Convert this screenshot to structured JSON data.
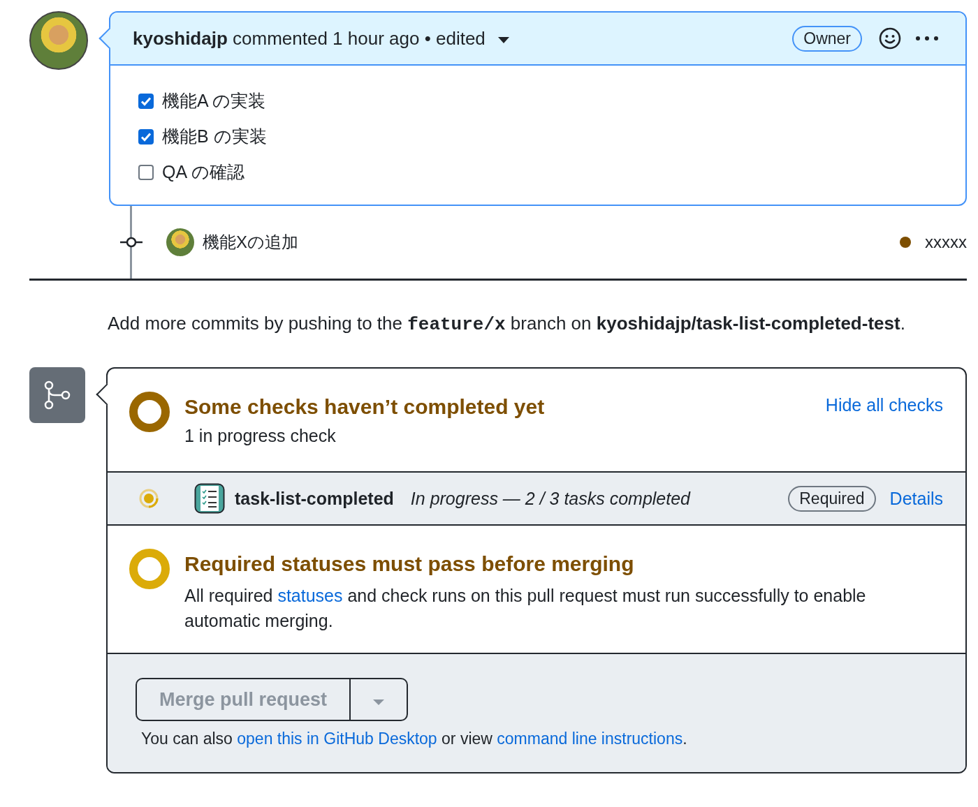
{
  "comment": {
    "author": "kyoshidajp",
    "action": "commented 1 hour ago",
    "separator": "•",
    "edited": "edited",
    "badge": "Owner",
    "tasks": [
      {
        "label": "機能A の実装",
        "checked": true
      },
      {
        "label": "機能B の実装",
        "checked": true
      },
      {
        "label": "QA の確認",
        "checked": false
      }
    ]
  },
  "commit": {
    "message": "機能Xの追加",
    "sha": "xxxxx"
  },
  "branch_note": "Add more commits by pushing to the **feature/x** branch on **kyoshidajp/task-list-completed-test**.",
  "checks": {
    "title": "Some checks haven’t completed yet",
    "subtitle": "1 in progress check",
    "toggle_link": "Hide all checks",
    "items": [
      {
        "name": "task-list-completed",
        "status": "In progress — 2 / 3 tasks completed",
        "badge": "Required",
        "link": "Details"
      }
    ]
  },
  "requirement": {
    "title": "Required statuses must pass before merging",
    "text_before": "All required",
    "link": "statuses",
    "text_after": "and check runs on this pull request must run successfully to enable automatic merging."
  },
  "merge": {
    "button": "Merge pull request",
    "disabled": true,
    "text_before": "You can also",
    "link_1": "open this in GitHub Desktop",
    "text_middle": "or view",
    "link_2": "command line instructions",
    "text_after": "."
  }
}
